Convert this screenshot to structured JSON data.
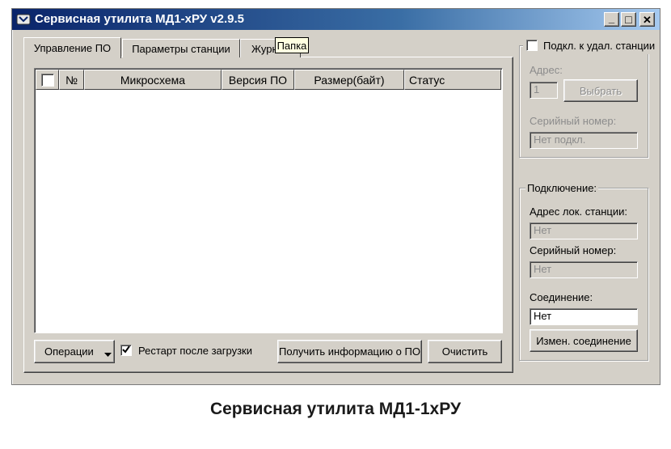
{
  "window": {
    "title": "Сервисная утилита МД1-хРУ v2.9.5",
    "caption_minimize": "_",
    "caption_maximize": "□",
    "caption_close": "✕"
  },
  "tabs": [
    {
      "label": "Управление ПО",
      "active": true
    },
    {
      "label": "Параметры станции",
      "active": false
    },
    {
      "label": "Журн",
      "active": false
    }
  ],
  "tooltip": "Папка",
  "table": {
    "columns": [
      "№",
      "Микросхема",
      "Версия ПО",
      "Размер(байт)",
      "Статус"
    ],
    "rows": []
  },
  "bottom": {
    "operations_label": "Операции",
    "restart_label": "Рестарт после загрузки",
    "restart_checked": true,
    "get_info_label": "Получить информацию о ПО",
    "clear_label": "Очистить"
  },
  "remote": {
    "checkbox_label": "Подкл. к удал. станции",
    "address_label": "Адрес:",
    "address_value": "1",
    "select_label": "Выбрать",
    "serial_label": "Серийный номер:",
    "serial_value": "Нет подкл."
  },
  "connection": {
    "group_title": "Подключение:",
    "local_address_label": "Адрес лок. станции:",
    "local_address_value": "Нет",
    "serial_label": "Серийный номер:",
    "serial_value": "Нет",
    "connection_label": "Соединение:",
    "connection_value": "Нет",
    "change_button_label": "Измен. соединение"
  },
  "caption": "Сервисная утилита МД1-1хРУ",
  "colors": {
    "titlebar_start": "#0a246a",
    "titlebar_end": "#a6caf0",
    "face": "#d4d0c8"
  }
}
